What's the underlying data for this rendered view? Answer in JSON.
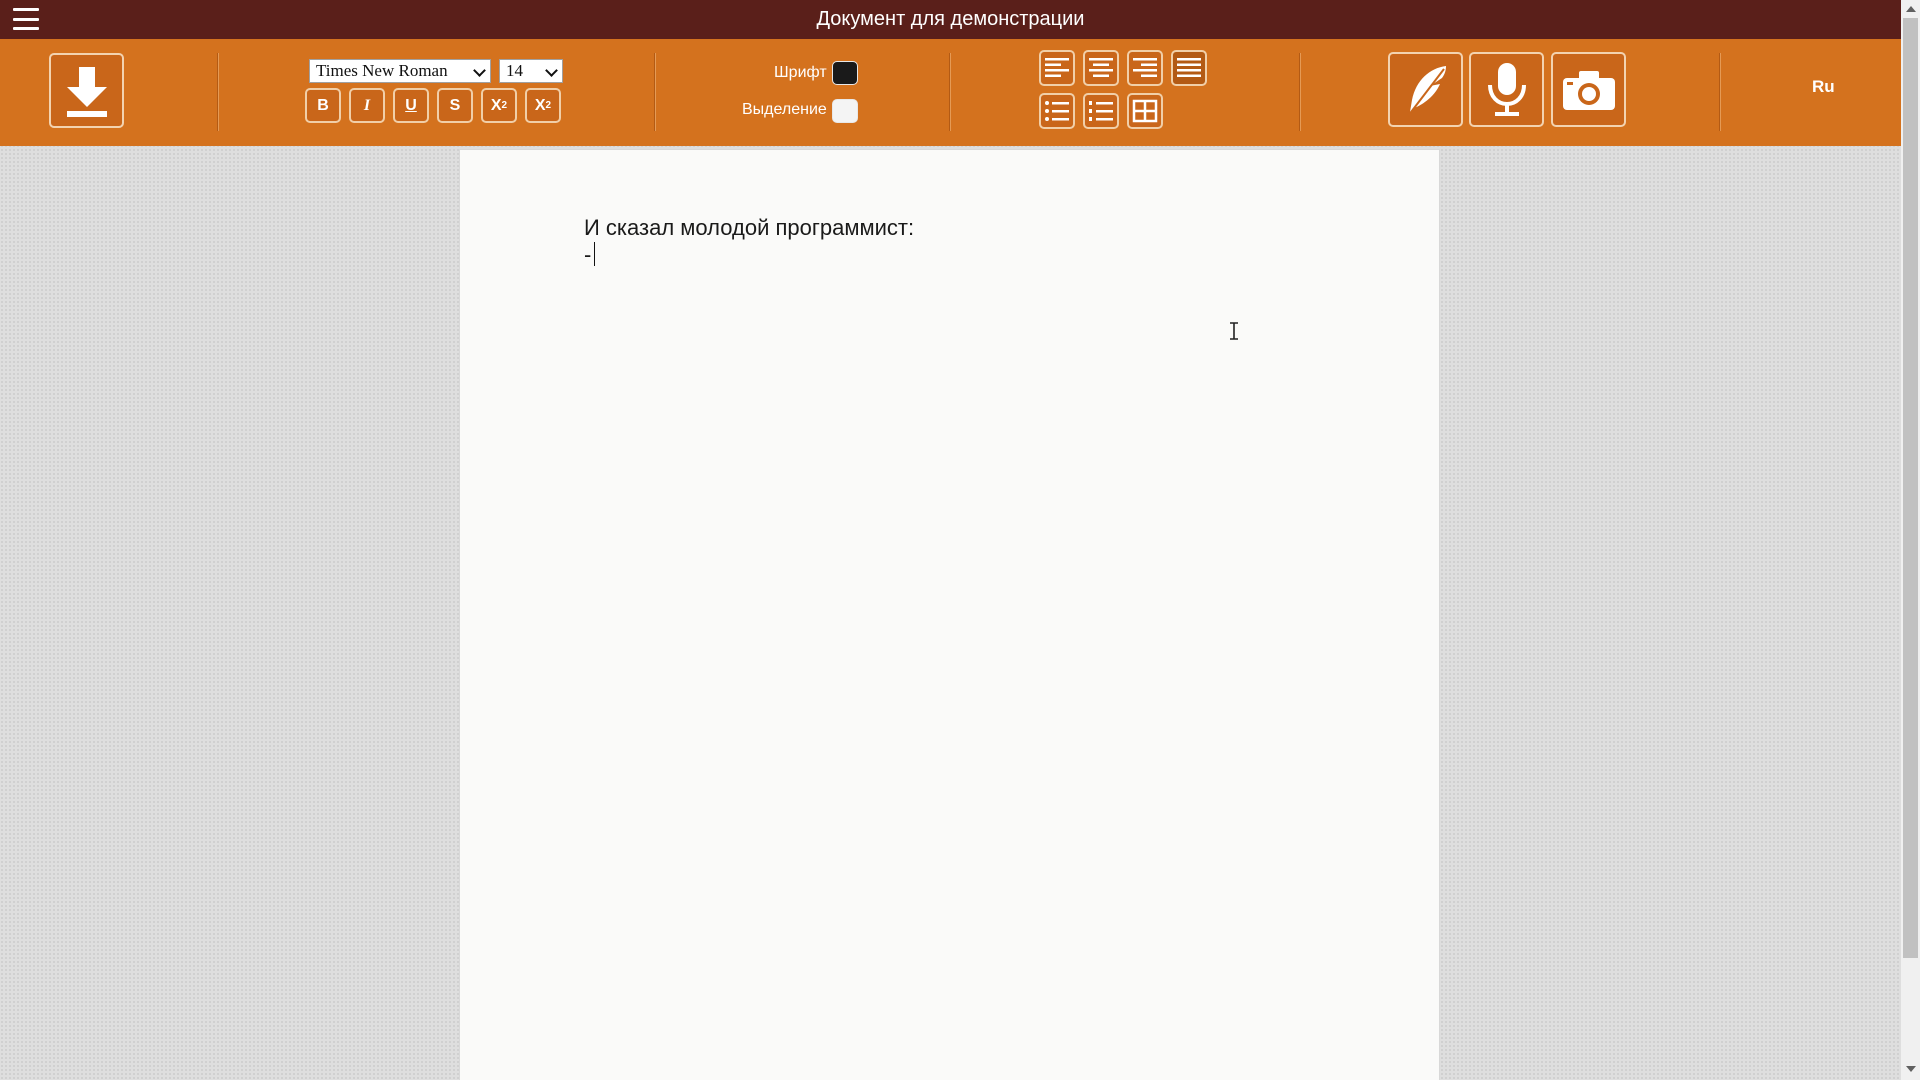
{
  "window": {
    "title": "Документ для демонстрации"
  },
  "toolbar": {
    "font_family": "Times New Roman",
    "font_size": "14",
    "bold": "B",
    "italic": "I",
    "underline": "U",
    "strike": "S",
    "subscript_base": "X",
    "subscript_index": "2",
    "superscript_base": "X",
    "superscript_index": "2",
    "font_color_label": "Шрифт",
    "highlight_label": "Выделение",
    "language": "Ru"
  },
  "colors": {
    "titlebar": "#5a1f1a",
    "toolbar": "#d4721e",
    "font_color": "#1a1a1a",
    "highlight_color": "#f4f4f4"
  },
  "document": {
    "line1": "И сказал молодой программист:",
    "line2": "-"
  },
  "icons": [
    "menu-icon",
    "download-icon",
    "align-left-icon",
    "align-center-icon",
    "align-right-icon",
    "align-justify-icon",
    "bullet-list-icon",
    "numbered-list-icon",
    "table-icon",
    "feather-icon",
    "microphone-icon",
    "camera-icon"
  ]
}
